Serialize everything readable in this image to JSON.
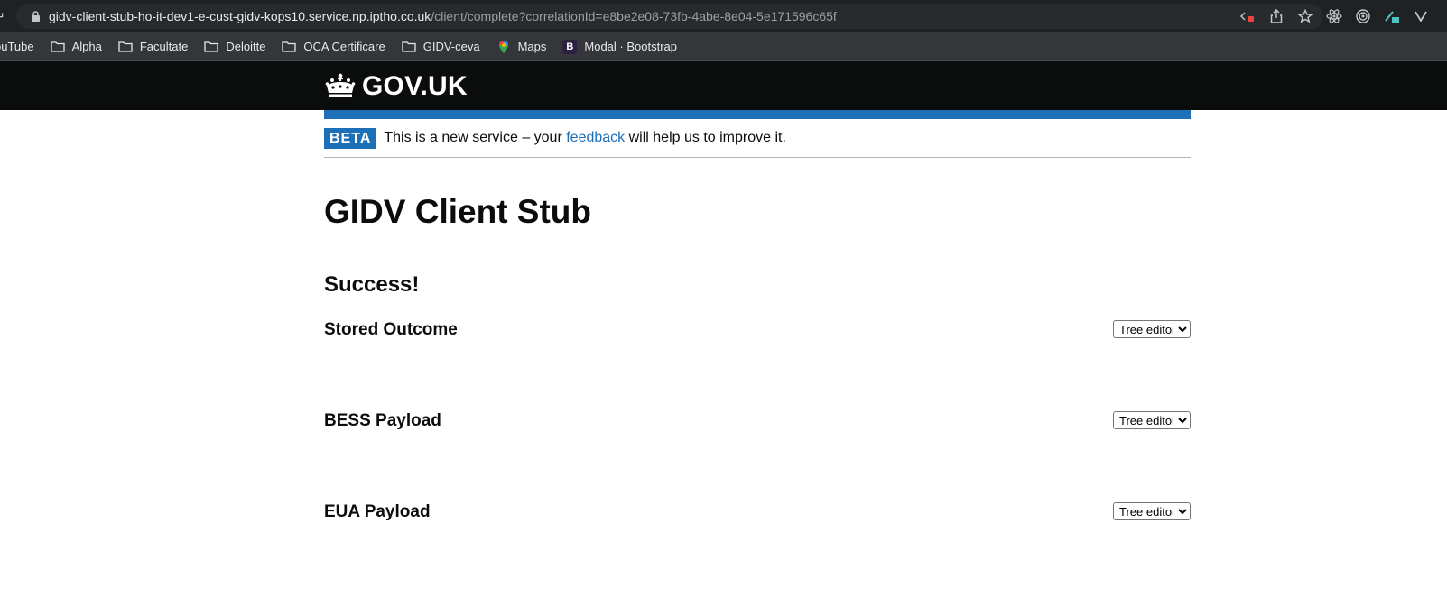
{
  "browser": {
    "url_host": "gidv-client-stub-ho-it-dev1-e-cust-gidv-kops10.service.np.iptho.co.uk",
    "url_path": "/client/complete?correlationId=e8be2e08-73fb-4abe-8e04-5e171596c65f",
    "toolbar_icons": [
      "devtools-icon",
      "share-icon",
      "bookmark-star-icon",
      "react-icon",
      "target-icon",
      "extension-icon",
      "menu-chevron-icon"
    ],
    "bookmarks": [
      {
        "label": "ouTube",
        "icon": "none"
      },
      {
        "label": "Alpha",
        "icon": "folder-icon"
      },
      {
        "label": "Facultate",
        "icon": "folder-icon"
      },
      {
        "label": "Deloitte",
        "icon": "folder-icon"
      },
      {
        "label": "OCA Certificare",
        "icon": "folder-icon"
      },
      {
        "label": "GIDV-ceva",
        "icon": "folder-icon"
      },
      {
        "label": "Maps",
        "icon": "maps-pin-icon"
      },
      {
        "label": "Modal · Bootstrap",
        "icon": "bootstrap-icon"
      }
    ]
  },
  "header": {
    "logo_text": "GOV.UK",
    "logo_icon": "crown-icon"
  },
  "phase_banner": {
    "tag": "BETA",
    "text_before": "This is a new service – your ",
    "link_text": "feedback",
    "text_after": " will help us to improve it."
  },
  "main": {
    "title": "GIDV Client Stub",
    "status": "Success!",
    "sections": [
      {
        "heading": "Stored Outcome",
        "editor_mode": "Tree editor"
      },
      {
        "heading": "BESS Payload",
        "editor_mode": "Tree editor"
      },
      {
        "heading": "EUA Payload",
        "editor_mode": "Tree editor"
      }
    ]
  },
  "colors": {
    "govuk_black": "#0b0c0c",
    "govuk_blue": "#1d70b8",
    "border_grey": "#b1b4b6"
  }
}
